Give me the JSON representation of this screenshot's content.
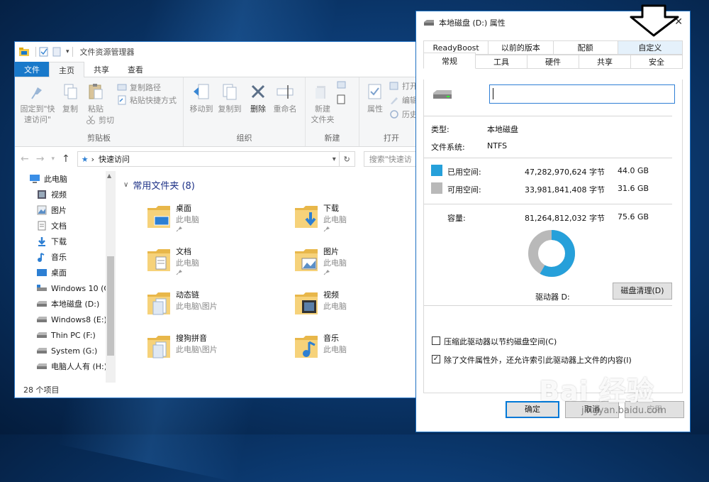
{
  "explorer": {
    "window_title": "文件资源管理器",
    "tabs": [
      {
        "label": "文件"
      },
      {
        "label": "主页"
      },
      {
        "label": "共享"
      },
      {
        "label": "查看"
      }
    ],
    "ribbon": {
      "pin_quick_access": "固定到\"快速访问\"",
      "copy": "复制",
      "paste": "粘贴",
      "copy_path": "复制路径",
      "paste_shortcut": "粘贴快捷方式",
      "cut": "剪切",
      "clipboard_group": "剪贴板",
      "move_to": "移动到",
      "copy_to": "复制到",
      "delete": "删除",
      "rename": "重命名",
      "organize_group": "组织",
      "new_folder_line1": "新建",
      "new_folder_line2": "文件夹",
      "new_group": "新建",
      "properties": "属性",
      "open": "打开",
      "edit": "编辑",
      "history": "历史",
      "open_group": "打开"
    },
    "address": {
      "path": "快速访问",
      "search_placeholder": "搜索\"快速访"
    },
    "nav_items": [
      {
        "label": "此电脑",
        "icon": "computer-icon"
      },
      {
        "label": "视频",
        "icon": "video-folder-icon"
      },
      {
        "label": "图片",
        "icon": "pictures-folder-icon"
      },
      {
        "label": "文档",
        "icon": "documents-folder-icon"
      },
      {
        "label": "下载",
        "icon": "downloads-icon"
      },
      {
        "label": "音乐",
        "icon": "music-icon"
      },
      {
        "label": "桌面",
        "icon": "desktop-icon"
      },
      {
        "label": "Windows 10 (C",
        "icon": "system-drive-icon"
      },
      {
        "label": "本地磁盘 (D:)",
        "icon": "drive-icon"
      },
      {
        "label": "Windows8 (E:)",
        "icon": "drive-icon"
      },
      {
        "label": "Thin PC (F:)",
        "icon": "drive-icon"
      },
      {
        "label": "System (G:)",
        "icon": "drive-icon"
      },
      {
        "label": "电脑人人有 (H:)",
        "icon": "drive-icon"
      }
    ],
    "group_heading": "常用文件夹 (8)",
    "folders": [
      {
        "name": "桌面",
        "location": "此电脑",
        "icon": "desktop-folder-icon"
      },
      {
        "name": "下载",
        "location": "此电脑",
        "icon": "downloads-folder-icon"
      },
      {
        "name": "文档",
        "location": "此电脑",
        "icon": "documents-folder-icon"
      },
      {
        "name": "图片",
        "location": "此电脑",
        "icon": "pictures-folder-icon"
      },
      {
        "name": "动态链",
        "location": "此电脑\\图片",
        "icon": "folder-icon"
      },
      {
        "name": "视频",
        "location": "此电脑",
        "icon": "video-folder-icon"
      },
      {
        "name": "搜狗拼音",
        "location": "此电脑\\图片",
        "icon": "folder-icon"
      },
      {
        "name": "音乐",
        "location": "此电脑",
        "icon": "music-folder-icon"
      }
    ],
    "status": "28 个项目"
  },
  "properties": {
    "title": "本地磁盘 (D:) 属性",
    "tabs_row1": [
      "ReadyBoost",
      "以前的版本",
      "配额",
      "自定义"
    ],
    "tabs_row2": [
      "常规",
      "工具",
      "硬件",
      "共享",
      "安全"
    ],
    "selected_tab": "常规",
    "volume_label_value": "",
    "type_label": "类型:",
    "type_value": "本地磁盘",
    "fs_label": "文件系统:",
    "fs_value": "NTFS",
    "used_label": "已用空间:",
    "used_bytes": "47,282,970,624 字节",
    "used_gb": "44.0 GB",
    "free_label": "可用空间:",
    "free_bytes": "33,981,841,408 字节",
    "free_gb": "31.6 GB",
    "capacity_label": "容量:",
    "capacity_bytes": "81,264,812,032 字节",
    "capacity_gb": "75.6 GB",
    "used_fraction": 0.582,
    "drive_label": "驱动器 D:",
    "cleanup_button": "磁盘清理(D)",
    "compress_label": "压缩此驱动器以节约磁盘空间(C)",
    "compress_checked": false,
    "index_label": "除了文件属性外，还允许索引此驱动器上文件的内容(I)",
    "index_checked": true,
    "ok": "确定",
    "cancel": "取消",
    "apply": "应用",
    "colors": {
      "used": "#26a0da",
      "free": "#b9b9b9"
    }
  },
  "watermark": {
    "text": "Bai 经验",
    "sub": "jingyan.baidu.com"
  }
}
